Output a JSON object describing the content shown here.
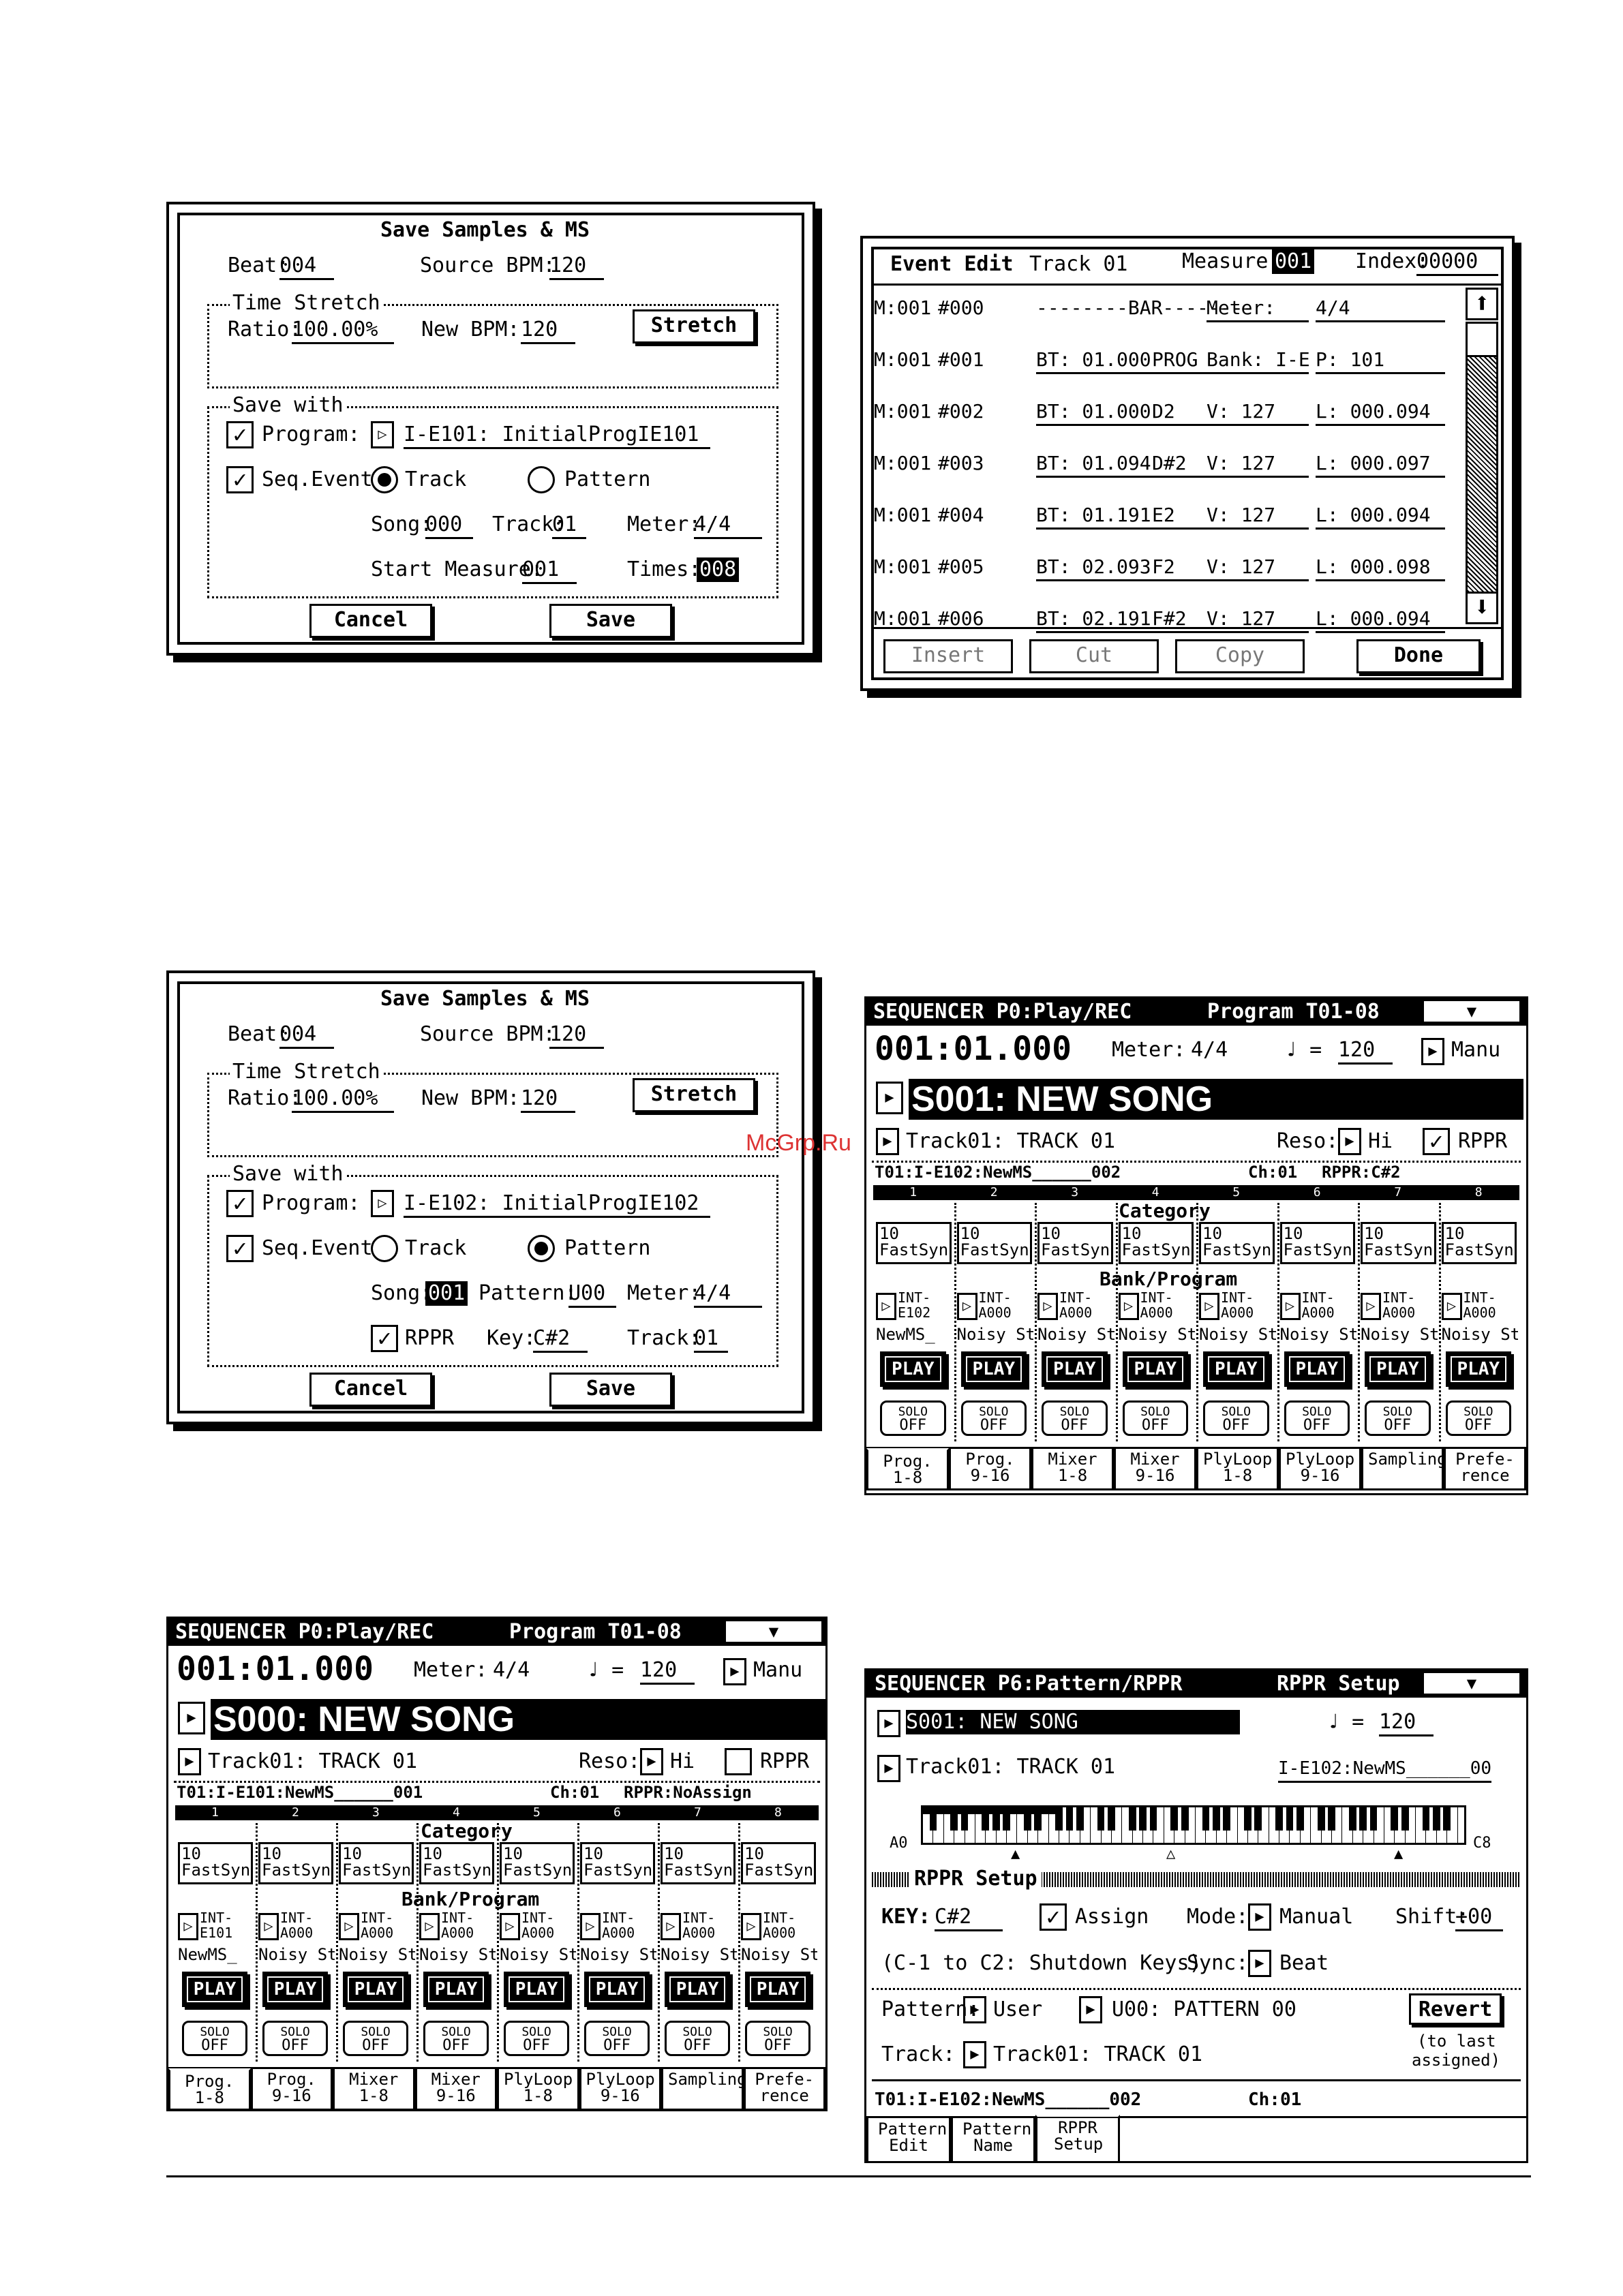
{
  "watermark": "McGrp.Ru",
  "dlg1": {
    "title": "Save Samples & MS",
    "beat_label": "Beat:",
    "beat": "004",
    "src_bpm_label": "Source BPM:",
    "src_bpm": "120",
    "ts_label": "Time Stretch",
    "ratio_label": "Ratio:",
    "ratio": "100.00%",
    "newbpm_label": "New BPM:",
    "newbpm": "120",
    "stretch": "Stretch",
    "save_with": "Save with",
    "program_label": "Program:",
    "program": "I-E101: InitialProgIE101",
    "seq_label": "Seq.Event",
    "track_label": "Track",
    "pattern_label": "Pattern",
    "song_label": "Song:",
    "song": "000",
    "trk_label": "Track:",
    "trk": "01",
    "meter_label": "Meter:",
    "meter": "4/4",
    "start_label": "Start Measure:",
    "start": "001",
    "times_label": "Times:",
    "times": "008",
    "cancel": "Cancel",
    "save": "Save"
  },
  "event": {
    "title": "Event Edit",
    "track": "Track 01",
    "measure_label": "Measure:",
    "measure": "001",
    "index_label": "Index:",
    "index": "00000",
    "rows": [
      {
        "m": "M:001",
        "n": "#000",
        "bt": "--------BAR--------",
        "b": "",
        "c": "Meter:",
        "d": "4/4"
      },
      {
        "m": "M:001",
        "n": "#001",
        "bt": "BT: 01.000",
        "b": "PROG",
        "c": "Bank: I-E",
        "d": "P: 101"
      },
      {
        "m": "M:001",
        "n": "#002",
        "bt": "BT: 01.000",
        "b": "D2",
        "c": "V: 127",
        "d": "L: 000.094"
      },
      {
        "m": "M:001",
        "n": "#003",
        "bt": "BT: 01.094",
        "b": "D#2",
        "c": "V: 127",
        "d": "L: 000.097"
      },
      {
        "m": "M:001",
        "n": "#004",
        "bt": "BT: 01.191",
        "b": "E2",
        "c": "V: 127",
        "d": "L: 000.094"
      },
      {
        "m": "M:001",
        "n": "#005",
        "bt": "BT: 02.093",
        "b": "F2",
        "c": "V: 127",
        "d": "L: 000.098"
      },
      {
        "m": "M:001",
        "n": "#006",
        "bt": "BT: 02.191",
        "b": "F#2",
        "c": "V: 127",
        "d": "L: 000.094"
      }
    ],
    "insert": "Insert",
    "cut": "Cut",
    "copy": "Copy",
    "done": "Done"
  },
  "dlg2": {
    "title": "Save Samples & MS",
    "beat_label": "Beat:",
    "beat": "004",
    "src_bpm_label": "Source BPM:",
    "src_bpm": "120",
    "ts_label": "Time Stretch",
    "ratio_label": "Ratio:",
    "ratio": "100.00%",
    "newbpm_label": "New BPM:",
    "newbpm": "120",
    "stretch": "Stretch",
    "save_with": "Save with",
    "program_label": "Program:",
    "program": "I-E102: InitialProgIE102",
    "seq_label": "Seq.Event",
    "track_label": "Track",
    "pattern_label": "Pattern",
    "song_label": "Song:",
    "song": "001",
    "pat_label": "Pattern:",
    "pat": "U00",
    "meter_label": "Meter:",
    "meter": "4/4",
    "rppr_label": "RPPR",
    "key_label": "Key:",
    "key": "C#2",
    "trk_label": "Track:",
    "trk": "01",
    "cancel": "Cancel",
    "save": "Save"
  },
  "seqA": {
    "header": "SEQUENCER P0:Play/REC",
    "header2": "Program T01-08",
    "loc": "001:01.000",
    "meter_label": "Meter:",
    "meter": "4/4",
    "tempo": "120",
    "manu": "Manu",
    "song": "S001: NEW SONG",
    "track": "Track01: TRACK 01",
    "reso_label": "Reso:",
    "reso": "Hi",
    "rppr": "RPPR",
    "info": "T01:I-E102:NewMS______002",
    "ch": "Ch:01",
    "rpprinfo": "RPPR:C#2",
    "category": "Category",
    "bankprog": "Bank/Program",
    "nums": [
      "1",
      "2",
      "3",
      "4",
      "5",
      "6",
      "7",
      "8"
    ],
    "cat": [
      "10 FastSyn",
      "10 FastSyn",
      "10 FastSyn",
      "10 FastSyn",
      "10 FastSyn",
      "10 FastSyn",
      "10 FastSyn",
      "10 FastSyn"
    ],
    "bank": [
      "INT- E102",
      "INT- A000",
      "INT- A000",
      "INT- A000",
      "INT- A000",
      "INT- A000",
      "INT- A000",
      "INT- A000"
    ],
    "names": [
      "NewMS_",
      "Noisy St",
      "Noisy St",
      "Noisy St",
      "Noisy St",
      "Noisy St",
      "Noisy St",
      "Noisy St"
    ],
    "play": "PLAY",
    "solo": "SOLO",
    "off": "OFF",
    "tabs": [
      "Prog. 1-8",
      "Prog. 9-16",
      "Mixer 1-8",
      "Mixer 9-16",
      "PlyLoop 1-8",
      "PlyLoop 9-16",
      "Sampling",
      "Prefe- rence"
    ]
  },
  "seqB": {
    "header": "SEQUENCER P0:Play/REC",
    "header2": "Program T01-08",
    "loc": "001:01.000",
    "meter_label": "Meter:",
    "meter": "4/4",
    "tempo": "120",
    "manu": "Manu",
    "song": "S000: NEW SONG",
    "track": "Track01: TRACK 01",
    "reso_label": "Reso:",
    "reso": "Hi",
    "rppr": "RPPR",
    "info": "T01:I-E101:NewMS______001",
    "ch": "Ch:01",
    "rpprinfo": "RPPR:NoAssign",
    "category": "Category",
    "bankprog": "Bank/Program",
    "nums": [
      "1",
      "2",
      "3",
      "4",
      "5",
      "6",
      "7",
      "8"
    ],
    "cat": [
      "10 FastSyn",
      "10 FastSyn",
      "10 FastSyn",
      "10 FastSyn",
      "10 FastSyn",
      "10 FastSyn",
      "10 FastSyn",
      "10 FastSyn"
    ],
    "bank": [
      "INT- E101",
      "INT- A000",
      "INT- A000",
      "INT- A000",
      "INT- A000",
      "INT- A000",
      "INT- A000",
      "INT- A000"
    ],
    "names": [
      "NewMS_",
      "Noisy St",
      "Noisy St",
      "Noisy St",
      "Noisy St",
      "Noisy St",
      "Noisy St",
      "Noisy St"
    ],
    "play": "PLAY",
    "solo": "SOLO",
    "off": "OFF",
    "tabs": [
      "Prog. 1-8",
      "Prog. 9-16",
      "Mixer 1-8",
      "Mixer 9-16",
      "PlyLoop 1-8",
      "PlyLoop 9-16",
      "Sampling",
      "Prefe- rence"
    ]
  },
  "rppr": {
    "header": "SEQUENCER P6:Pattern/RPPR",
    "header2": "RPPR Setup",
    "song": "S001: NEW SONG",
    "tempo": "120",
    "track": "Track01: TRACK 01",
    "trkinfo": "I-E102:NewMS______00",
    "a0": "A0",
    "c8": "C8",
    "setup": "RPPR Setup",
    "key_label": "KEY:",
    "key": "C#2",
    "assign": "Assign",
    "mode_label": "Mode:",
    "mode": "Manual",
    "shift_label": "Shift:",
    "shift": "+00",
    "shutdown": "(C-1 to C2: Shutdown Keys)",
    "sync_label": "Sync:",
    "sync": "Beat",
    "pattern_label": "Pattern:",
    "pattern": "User",
    "pattern2": "U00: PATTERN 00",
    "revert": "Revert",
    "revert_note1": "(to last",
    "revert_note2": "assigned)",
    "track_label": "Track:",
    "track2": "Track01: TRACK 01",
    "info": "T01:I-E102:NewMS______002",
    "ch": "Ch:01",
    "tabs": [
      "Pattern Edit",
      "Pattern Name",
      "RPPR Setup"
    ]
  }
}
